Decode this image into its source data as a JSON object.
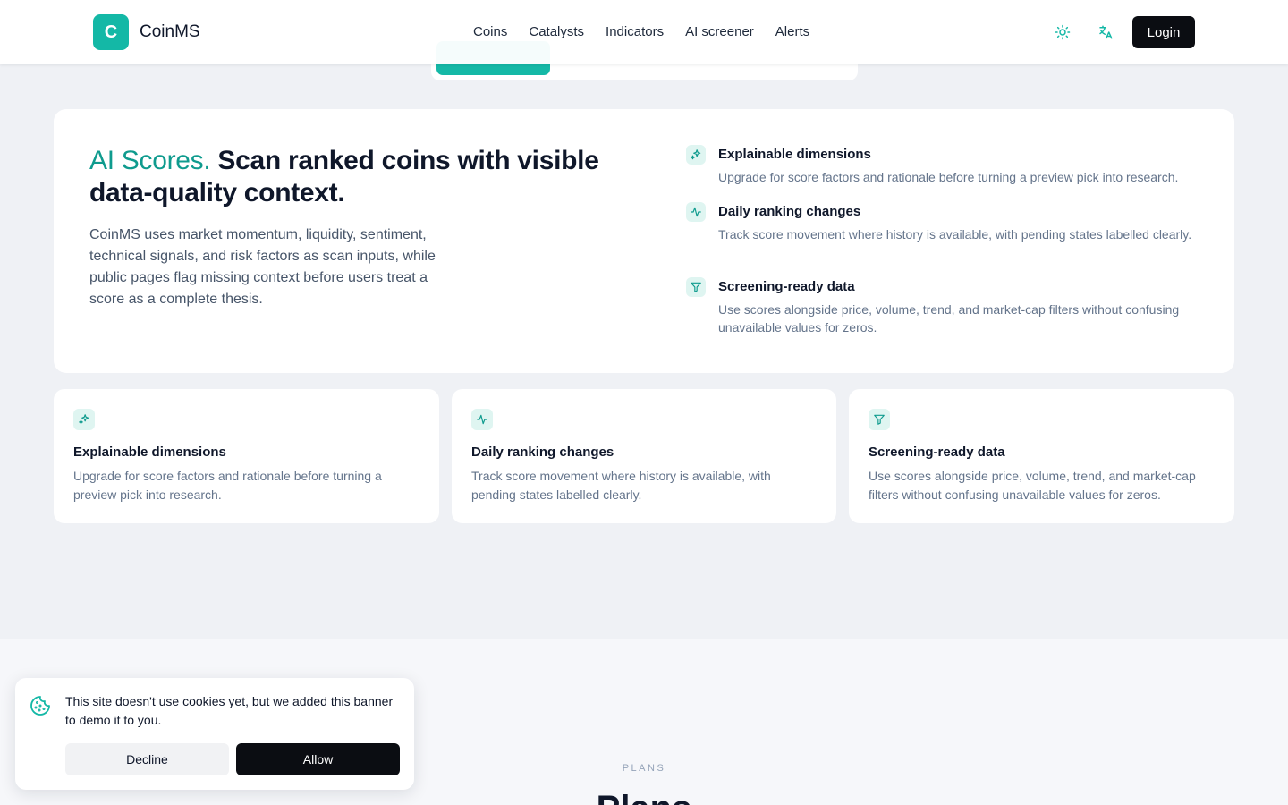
{
  "header": {
    "logo_letter": "C",
    "brand": "CoinMS",
    "nav": [
      "Coins",
      "Catalysts",
      "Indicators",
      "AI screener",
      "Alerts"
    ],
    "theme_icon": "sun-icon",
    "language_icon": "translate-icon",
    "login_label": "Login"
  },
  "hero": {
    "title_accent": "AI Scores.",
    "title_rest": " Scan ranked coins with visible data-quality context.",
    "description": "CoinMS uses market momentum, liquidity, sentiment, technical signals, and risk factors as scan inputs, while public pages flag missing context before users treat a score as a complete thesis.",
    "features": [
      {
        "icon": "sparkles-icon",
        "title": "Explainable dimensions",
        "desc": "Upgrade for score factors and rationale before turning a preview pick into research."
      },
      {
        "icon": "activity-icon",
        "title": "Daily ranking changes",
        "desc": "Track score movement where history is available, with pending states labelled clearly."
      },
      {
        "icon": "filter-icon",
        "title": "Screening-ready data",
        "desc": "Use scores alongside price, volume, trend, and market-cap filters without confusing unavailable values for zeros."
      }
    ]
  },
  "cards": [
    {
      "icon": "sparkles-icon",
      "title": "Explainable dimensions",
      "desc": "Upgrade for score factors and rationale before turning a preview pick into research."
    },
    {
      "icon": "activity-icon",
      "title": "Daily ranking changes",
      "desc": "Track score movement where history is available, with pending states labelled clearly."
    },
    {
      "icon": "filter-icon",
      "title": "Screening-ready data",
      "desc": "Use scores alongside price, volume, trend, and market-cap filters without confusing unavailable values for zeros."
    }
  ],
  "plans": {
    "kicker": "PLANS",
    "title": "Plans"
  },
  "cookie": {
    "icon": "cookie-icon",
    "text": "This site doesn't use cookies yet, but we added this banner to demo it to you.",
    "decline_label": "Decline",
    "allow_label": "Allow"
  },
  "colors": {
    "accent": "#14b8a6",
    "accent_text": "#0f9b8e",
    "dark_button": "#0b0d12",
    "background": "#eff1f5"
  }
}
